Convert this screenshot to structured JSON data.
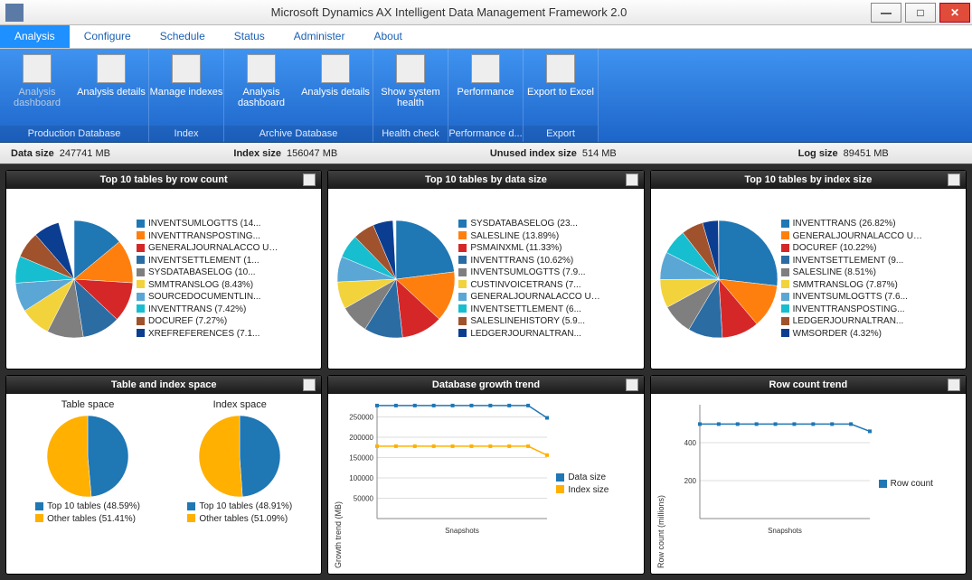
{
  "window": {
    "title": "Microsoft Dynamics AX Intelligent Data Management Framework 2.0"
  },
  "menu": {
    "items": [
      "Analysis",
      "Configure",
      "Schedule",
      "Status",
      "Administer",
      "About"
    ],
    "active": "Analysis"
  },
  "ribbon": {
    "groups": [
      {
        "label": "Production Database",
        "buttons": [
          {
            "label": "Analysis dashboard",
            "disabled": true
          },
          {
            "label": "Analysis details"
          }
        ]
      },
      {
        "label": "Index",
        "buttons": [
          {
            "label": "Manage indexes"
          }
        ]
      },
      {
        "label": "Archive Database",
        "buttons": [
          {
            "label": "Analysis dashboard"
          },
          {
            "label": "Analysis details"
          }
        ]
      },
      {
        "label": "Health check",
        "buttons": [
          {
            "label": "Show system health"
          }
        ]
      },
      {
        "label": "Performance d...",
        "buttons": [
          {
            "label": "Performance"
          }
        ]
      },
      {
        "label": "Export",
        "buttons": [
          {
            "label": "Export to Excel"
          }
        ]
      }
    ]
  },
  "stats": {
    "data_size_label": "Data size",
    "data_size_val": "247741 MB",
    "index_size_label": "Index size",
    "index_size_val": "156047 MB",
    "unused_label": "Unused index size",
    "unused_val": "514 MB",
    "log_label": "Log size",
    "log_val": "89451 MB"
  },
  "colors": [
    "#1f77b4",
    "#ff7f0e",
    "#2ca02c",
    "#d62728",
    "#17becf",
    "#8c564b",
    "#e377c2",
    "#7f7f7f",
    "#bcbd22",
    "#9edae5"
  ],
  "panels": {
    "p1": {
      "title": "Top 10 tables by row count"
    },
    "p2": {
      "title": "Top 10 tables by data size"
    },
    "p3": {
      "title": "Top 10 tables by index size"
    },
    "p4": {
      "title": "Table and index space",
      "sub1": "Table space",
      "sub2": "Index space"
    },
    "p5": {
      "title": "Database growth trend"
    },
    "p6": {
      "title": "Row count trend"
    }
  },
  "chart_data": [
    {
      "id": "top10_rowcount",
      "type": "pie",
      "title": "Top 10 tables by row count",
      "series": [
        {
          "name": "INVENTSUMLOGTTS",
          "pct": 14.0,
          "label": "INVENTSUMLOGTTS (14...",
          "color": "#1f77b4"
        },
        {
          "name": "INVENTTRANSPOSTING",
          "pct": 12.0,
          "label": "INVENTTRANSPOSTING...",
          "color": "#ff7f0e"
        },
        {
          "name": "GENERALJOURNALACCOUNTENTRY",
          "pct": 11.0,
          "label": "GENERALJOURNALACCO UNTENTRY...",
          "color": "#d62728"
        },
        {
          "name": "INVENTSETTLEMENT",
          "pct": 10.5,
          "label": "INVENTSETTLEMENT (1...",
          "color": "#2b6ca3"
        },
        {
          "name": "SYSDATABASELOG",
          "pct": 10.0,
          "label": "SYSDATABASELOG (10...",
          "color": "#7f7f7f"
        },
        {
          "name": "SMMTRANSLOG",
          "pct": 8.43,
          "label": "SMMTRANSLOG (8.43%)",
          "color": "#f2d33b"
        },
        {
          "name": "SOURCEDOCUMENTLINE",
          "pct": 8.0,
          "label": "SOURCEDOCUMENTLIN...",
          "color": "#5aa7d6"
        },
        {
          "name": "INVENTTRANS",
          "pct": 7.42,
          "label": "INVENTTRANS (7.42%)",
          "color": "#17becf"
        },
        {
          "name": "DOCUREF",
          "pct": 7.27,
          "label": "DOCUREF (7.27%)",
          "color": "#a0522d"
        },
        {
          "name": "XREFREFERENCES",
          "pct": 7.1,
          "label": "XREFREFERENCES (7.1...",
          "color": "#0b3d91"
        }
      ]
    },
    {
      "id": "top10_datasize",
      "type": "pie",
      "title": "Top 10 tables by data size",
      "series": [
        {
          "name": "SYSDATABASELOG",
          "pct": 23.0,
          "label": "SYSDATABASELOG (23...",
          "color": "#1f77b4"
        },
        {
          "name": "SALESLINE",
          "pct": 13.89,
          "label": "SALESLINE (13.89%)",
          "color": "#ff7f0e"
        },
        {
          "name": "PSMAINXML",
          "pct": 11.33,
          "label": "PSMAINXML (11.33%)",
          "color": "#d62728"
        },
        {
          "name": "INVENTTRANS",
          "pct": 10.62,
          "label": "INVENTTRANS (10.62%)",
          "color": "#2b6ca3"
        },
        {
          "name": "INVENTSUMLOGTTS",
          "pct": 7.9,
          "label": "INVENTSUMLOGTTS (7.9...",
          "color": "#7f7f7f"
        },
        {
          "name": "CUSTINVOICETRANS",
          "pct": 7.5,
          "label": "CUSTINVOICETRANS (7...",
          "color": "#f2d33b"
        },
        {
          "name": "GENERALJOURNALACCOUNTENTRY",
          "pct": 7.0,
          "label": "GENERALJOURNALACCO UNTENTRY...",
          "color": "#5aa7d6"
        },
        {
          "name": "INVENTSETTLEMENT",
          "pct": 6.5,
          "label": "INVENTSETTLEMENT (6...",
          "color": "#17becf"
        },
        {
          "name": "SALESLINEHISTORY",
          "pct": 5.9,
          "label": "SALESLINEHISTORY (5.9...",
          "color": "#a0522d"
        },
        {
          "name": "LEDGERJOURNALTRANS",
          "pct": 5.5,
          "label": "LEDGERJOURNALTRAN...",
          "color": "#0b3d91"
        }
      ]
    },
    {
      "id": "top10_indexsize",
      "type": "pie",
      "title": "Top 10 tables by index size",
      "series": [
        {
          "name": "INVENTTRANS",
          "pct": 26.82,
          "label": "INVENTTRANS (26.82%)",
          "color": "#1f77b4"
        },
        {
          "name": "GENERALJOURNALACCOUNTENTRY",
          "pct": 12.0,
          "label": "GENERALJOURNALACCO UNTENTRY...",
          "color": "#ff7f0e"
        },
        {
          "name": "DOCUREF",
          "pct": 10.22,
          "label": "DOCUREF (10.22%)",
          "color": "#d62728"
        },
        {
          "name": "INVENTSETTLEMENT",
          "pct": 9.5,
          "label": "INVENTSETTLEMENT (9...",
          "color": "#2b6ca3"
        },
        {
          "name": "SALESLINE",
          "pct": 8.51,
          "label": "SALESLINE (8.51%)",
          "color": "#7f7f7f"
        },
        {
          "name": "SMMTRANSLOG",
          "pct": 7.87,
          "label": "SMMTRANSLOG (7.87%)",
          "color": "#f2d33b"
        },
        {
          "name": "INVENTSUMLOGTTS",
          "pct": 7.6,
          "label": "INVENTSUMLOGTTS (7.6...",
          "color": "#5aa7d6"
        },
        {
          "name": "INVENTTRANSPOSTING",
          "pct": 7.0,
          "label": "INVENTTRANSPOSTING...",
          "color": "#17becf"
        },
        {
          "name": "LEDGERJOURNALTRANS",
          "pct": 6.0,
          "label": "LEDGERJOURNALTRAN...",
          "color": "#a0522d"
        },
        {
          "name": "WMSORDER",
          "pct": 4.32,
          "label": "WMSORDER (4.32%)",
          "color": "#0b3d91"
        }
      ]
    },
    {
      "id": "table_space",
      "type": "pie",
      "title": "Table space",
      "series": [
        {
          "name": "Top 10 tables",
          "pct": 48.59,
          "label": "Top 10 tables (48.59%)",
          "color": "#1f77b4"
        },
        {
          "name": "Other tables",
          "pct": 51.41,
          "label": "Other tables (51.41%)",
          "color": "#ffb000"
        }
      ]
    },
    {
      "id": "index_space",
      "type": "pie",
      "title": "Index space",
      "series": [
        {
          "name": "Top 10 tables",
          "pct": 48.91,
          "label": "Top 10 tables (48.91%)",
          "color": "#1f77b4"
        },
        {
          "name": "Other tables",
          "pct": 51.09,
          "label": "Other tables (51.09%)",
          "color": "#ffb000"
        }
      ]
    },
    {
      "id": "db_growth",
      "type": "line",
      "title": "Database growth trend",
      "xlabel": "Snapshots",
      "ylabel": "Growth trend (MB)",
      "ylim": [
        0,
        280000
      ],
      "yticks": [
        50000,
        100000,
        150000,
        200000,
        250000
      ],
      "x": [
        1,
        2,
        3,
        4,
        5,
        6,
        7,
        8,
        9,
        10
      ],
      "series": [
        {
          "name": "Data size",
          "color": "#1f77b4",
          "values": [
            278000,
            278000,
            278000,
            278000,
            278000,
            278000,
            278000,
            278000,
            278000,
            247741
          ]
        },
        {
          "name": "Index size",
          "color": "#ffb000",
          "values": [
            178000,
            178000,
            178000,
            178000,
            178000,
            178000,
            178000,
            178000,
            178000,
            156047
          ]
        }
      ]
    },
    {
      "id": "row_count_trend",
      "type": "line",
      "title": "Row count trend",
      "xlabel": "Snapshots",
      "ylabel": "Row count (millions)",
      "ylim": [
        0,
        600
      ],
      "yticks": [
        200,
        400
      ],
      "x": [
        1,
        2,
        3,
        4,
        5,
        6,
        7,
        8,
        9,
        10
      ],
      "series": [
        {
          "name": "Row count",
          "color": "#1f77b4",
          "values": [
            498,
            498,
            498,
            498,
            498,
            498,
            498,
            498,
            498,
            460
          ]
        }
      ]
    }
  ]
}
